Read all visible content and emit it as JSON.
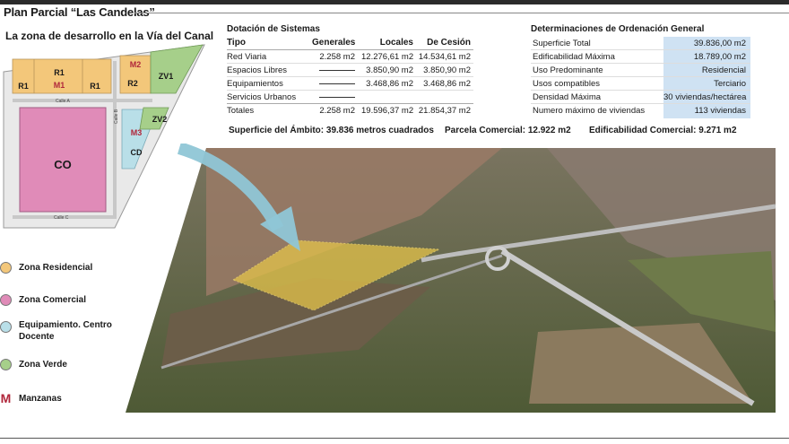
{
  "header": {
    "title": "Plan Parcial “Las Candelas”",
    "subtitle": "La zona de desarrollo en la Vía del Canal"
  },
  "map": {
    "zones": {
      "r1": "R1",
      "m1": "M1",
      "r2": "R2",
      "m2": "M2",
      "zv1": "ZV1",
      "zv2": "ZV2",
      "m3": "M3",
      "cd": "CD",
      "co": "CO"
    },
    "streets": {
      "calle_a": "Calle A",
      "calle_b": "Calle B",
      "calle_c": "Calle C"
    }
  },
  "legend": [
    {
      "label": "Zona Residencial",
      "color": "#f3c77a",
      "kind": "dot"
    },
    {
      "label": "Zona Comercial",
      "color": "#e08bb8",
      "kind": "dot"
    },
    {
      "label": "Equipamiento. Centro Docente",
      "color": "#b9dfe8",
      "kind": "dot"
    },
    {
      "label": "Zona Verde",
      "color": "#a6cf8a",
      "kind": "dot"
    },
    {
      "label": "Manzanas",
      "color": "#b0263a",
      "kind": "letter",
      "symbol": "M"
    }
  ],
  "dotacion": {
    "title": "Dotación de Sistemas",
    "columns": [
      "Tipo",
      "Generales",
      "Locales",
      "De Cesión"
    ],
    "rows": [
      {
        "tipo": "Red Viaria",
        "generales": "2.258 m2",
        "locales": "12.276,61 m2",
        "cesion": "14.534,61 m2"
      },
      {
        "tipo": "Espacios Libres",
        "generales": "",
        "locales": "3.850,90 m2",
        "cesion": "3.850,90 m2"
      },
      {
        "tipo": "Equipamientos",
        "generales": "",
        "locales": "3.468,86 m2",
        "cesion": "3.468,86 m2"
      },
      {
        "tipo": "Servicios Urbanos",
        "generales": "",
        "locales": "",
        "cesion": ""
      },
      {
        "tipo": "Totales",
        "generales": "2.258 m2",
        "locales": "19.596,37 m2",
        "cesion": "21.854,37 m2"
      }
    ]
  },
  "determinaciones": {
    "title": "Determinaciones de Ordenación General",
    "rows": [
      {
        "label": "Superficie Total",
        "value": "39.836,00 m2"
      },
      {
        "label": "Edificabilidad Máxima",
        "value": "18.789,00 m2"
      },
      {
        "label": "Uso Predominante",
        "value": "Residencial"
      },
      {
        "label": "Usos compatibles",
        "value": "Terciario"
      },
      {
        "label": "Densidad Máxima",
        "value": "30 viviendas/hectárea"
      },
      {
        "label": "Numero máximo de viviendas",
        "value": "113 viviendas"
      }
    ]
  },
  "stats": {
    "superficie": "Superficie del Ámbito: 39.836 metros cuadrados",
    "parcela": "Parcela Comercial: 12.922 m2",
    "edificabilidad": "Edificabilidad Comercial: 9.271 m2"
  },
  "colors": {
    "residencial": "#f3c77a",
    "comercial": "#e08bb8",
    "equipamiento": "#b9dfe8",
    "verde": "#a6cf8a",
    "manzana": "#b0263a",
    "value_box": "#cfe2f3"
  }
}
